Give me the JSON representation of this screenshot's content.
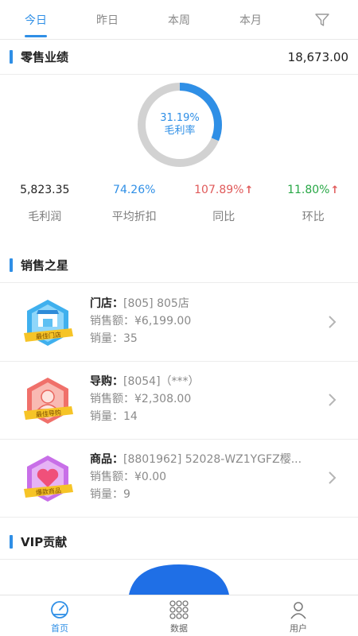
{
  "tabs": [
    "今日",
    "昨日",
    "本周",
    "本月"
  ],
  "retail": {
    "title": "零售业绩",
    "total": "18,673.00",
    "gross_margin_rate": "31.19%",
    "gross_margin_rate_fraction": 0.3119,
    "gross_margin_label": "毛利率"
  },
  "stats": [
    {
      "value": "5,823.35",
      "label": "毛利润"
    },
    {
      "value": "74.26%",
      "label": "平均折扣"
    },
    {
      "value": "107.89%",
      "label": "同比"
    },
    {
      "value": "11.80%",
      "label": "环比"
    }
  ],
  "stars": {
    "title": "销售之星",
    "rows": [
      {
        "category": "门店：",
        "name": "[805] 805店",
        "amount_label": "销售额：",
        "amount": "¥6,199.00",
        "qty_label": "销量：",
        "qty": "35",
        "badge": "最佳门店"
      },
      {
        "category": "导购：",
        "name": "[8054]（***）",
        "amount_label": "销售额：",
        "amount": "¥2,308.00",
        "qty_label": "销量：",
        "qty": "14",
        "badge": "最佳导购"
      },
      {
        "category": "商品：",
        "name": "[8801962] 52028-WZ1YGFZ樱...",
        "amount_label": "销售额：",
        "amount": "¥0.00",
        "qty_label": "销量：",
        "qty": "9",
        "badge": "爆款商品"
      }
    ]
  },
  "vip": {
    "title": "VIP贡献"
  },
  "nav": [
    "首页",
    "数据",
    "用户"
  ],
  "colors": {
    "accent": "#2f8fe6",
    "up_red": "#e05a5a",
    "up_green": "#27a745"
  }
}
